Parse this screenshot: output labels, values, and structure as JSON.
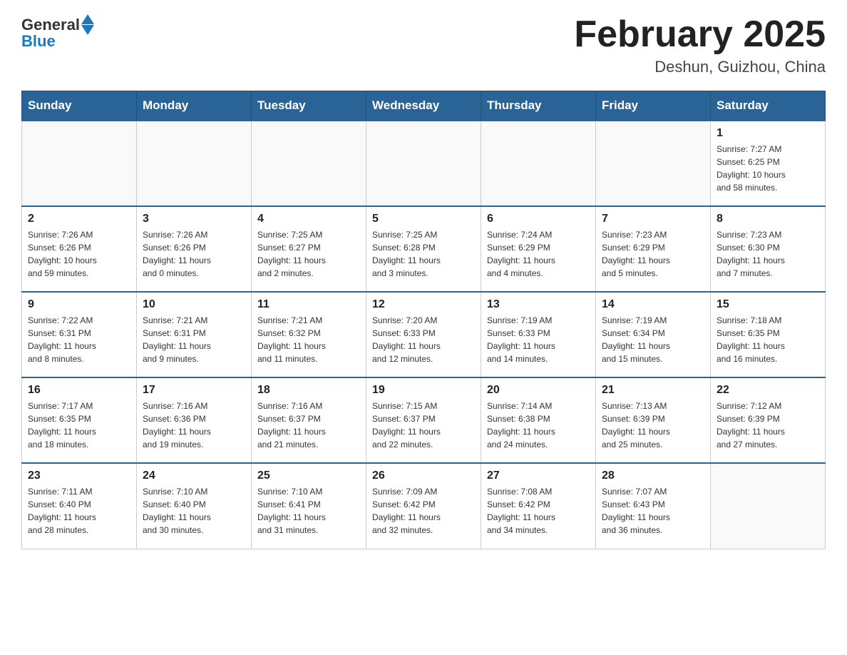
{
  "header": {
    "logo_general": "General",
    "logo_blue": "Blue",
    "title": "February 2025",
    "subtitle": "Deshun, Guizhou, China"
  },
  "weekdays": [
    "Sunday",
    "Monday",
    "Tuesday",
    "Wednesday",
    "Thursday",
    "Friday",
    "Saturday"
  ],
  "weeks": [
    [
      {
        "day": "",
        "info": ""
      },
      {
        "day": "",
        "info": ""
      },
      {
        "day": "",
        "info": ""
      },
      {
        "day": "",
        "info": ""
      },
      {
        "day": "",
        "info": ""
      },
      {
        "day": "",
        "info": ""
      },
      {
        "day": "1",
        "info": "Sunrise: 7:27 AM\nSunset: 6:25 PM\nDaylight: 10 hours\nand 58 minutes."
      }
    ],
    [
      {
        "day": "2",
        "info": "Sunrise: 7:26 AM\nSunset: 6:26 PM\nDaylight: 10 hours\nand 59 minutes."
      },
      {
        "day": "3",
        "info": "Sunrise: 7:26 AM\nSunset: 6:26 PM\nDaylight: 11 hours\nand 0 minutes."
      },
      {
        "day": "4",
        "info": "Sunrise: 7:25 AM\nSunset: 6:27 PM\nDaylight: 11 hours\nand 2 minutes."
      },
      {
        "day": "5",
        "info": "Sunrise: 7:25 AM\nSunset: 6:28 PM\nDaylight: 11 hours\nand 3 minutes."
      },
      {
        "day": "6",
        "info": "Sunrise: 7:24 AM\nSunset: 6:29 PM\nDaylight: 11 hours\nand 4 minutes."
      },
      {
        "day": "7",
        "info": "Sunrise: 7:23 AM\nSunset: 6:29 PM\nDaylight: 11 hours\nand 5 minutes."
      },
      {
        "day": "8",
        "info": "Sunrise: 7:23 AM\nSunset: 6:30 PM\nDaylight: 11 hours\nand 7 minutes."
      }
    ],
    [
      {
        "day": "9",
        "info": "Sunrise: 7:22 AM\nSunset: 6:31 PM\nDaylight: 11 hours\nand 8 minutes."
      },
      {
        "day": "10",
        "info": "Sunrise: 7:21 AM\nSunset: 6:31 PM\nDaylight: 11 hours\nand 9 minutes."
      },
      {
        "day": "11",
        "info": "Sunrise: 7:21 AM\nSunset: 6:32 PM\nDaylight: 11 hours\nand 11 minutes."
      },
      {
        "day": "12",
        "info": "Sunrise: 7:20 AM\nSunset: 6:33 PM\nDaylight: 11 hours\nand 12 minutes."
      },
      {
        "day": "13",
        "info": "Sunrise: 7:19 AM\nSunset: 6:33 PM\nDaylight: 11 hours\nand 14 minutes."
      },
      {
        "day": "14",
        "info": "Sunrise: 7:19 AM\nSunset: 6:34 PM\nDaylight: 11 hours\nand 15 minutes."
      },
      {
        "day": "15",
        "info": "Sunrise: 7:18 AM\nSunset: 6:35 PM\nDaylight: 11 hours\nand 16 minutes."
      }
    ],
    [
      {
        "day": "16",
        "info": "Sunrise: 7:17 AM\nSunset: 6:35 PM\nDaylight: 11 hours\nand 18 minutes."
      },
      {
        "day": "17",
        "info": "Sunrise: 7:16 AM\nSunset: 6:36 PM\nDaylight: 11 hours\nand 19 minutes."
      },
      {
        "day": "18",
        "info": "Sunrise: 7:16 AM\nSunset: 6:37 PM\nDaylight: 11 hours\nand 21 minutes."
      },
      {
        "day": "19",
        "info": "Sunrise: 7:15 AM\nSunset: 6:37 PM\nDaylight: 11 hours\nand 22 minutes."
      },
      {
        "day": "20",
        "info": "Sunrise: 7:14 AM\nSunset: 6:38 PM\nDaylight: 11 hours\nand 24 minutes."
      },
      {
        "day": "21",
        "info": "Sunrise: 7:13 AM\nSunset: 6:39 PM\nDaylight: 11 hours\nand 25 minutes."
      },
      {
        "day": "22",
        "info": "Sunrise: 7:12 AM\nSunset: 6:39 PM\nDaylight: 11 hours\nand 27 minutes."
      }
    ],
    [
      {
        "day": "23",
        "info": "Sunrise: 7:11 AM\nSunset: 6:40 PM\nDaylight: 11 hours\nand 28 minutes."
      },
      {
        "day": "24",
        "info": "Sunrise: 7:10 AM\nSunset: 6:40 PM\nDaylight: 11 hours\nand 30 minutes."
      },
      {
        "day": "25",
        "info": "Sunrise: 7:10 AM\nSunset: 6:41 PM\nDaylight: 11 hours\nand 31 minutes."
      },
      {
        "day": "26",
        "info": "Sunrise: 7:09 AM\nSunset: 6:42 PM\nDaylight: 11 hours\nand 32 minutes."
      },
      {
        "day": "27",
        "info": "Sunrise: 7:08 AM\nSunset: 6:42 PM\nDaylight: 11 hours\nand 34 minutes."
      },
      {
        "day": "28",
        "info": "Sunrise: 7:07 AM\nSunset: 6:43 PM\nDaylight: 11 hours\nand 36 minutes."
      },
      {
        "day": "",
        "info": ""
      }
    ]
  ]
}
